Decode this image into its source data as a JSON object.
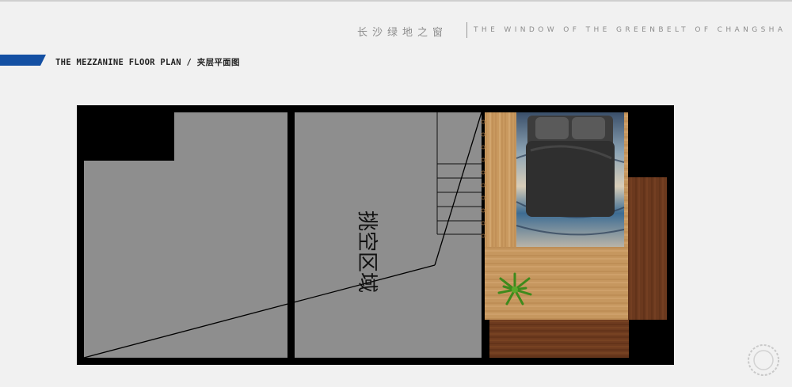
{
  "header": {
    "title_cn": "长沙绿地之窗",
    "title_en": "THE WINDOW OF THE GREENBELT OF CHANGSHA"
  },
  "section": {
    "subtitle": "THE MEZZANINE FLOOR PLAN / 夹层平面图"
  },
  "plan": {
    "void_label": "挑空区域"
  },
  "colors": {
    "accent": "#1450a3",
    "wall": "#000000",
    "void_floor": "#8e8e8e",
    "wood_light": "#c89a66",
    "wood_dark": "#6b3a1f"
  }
}
